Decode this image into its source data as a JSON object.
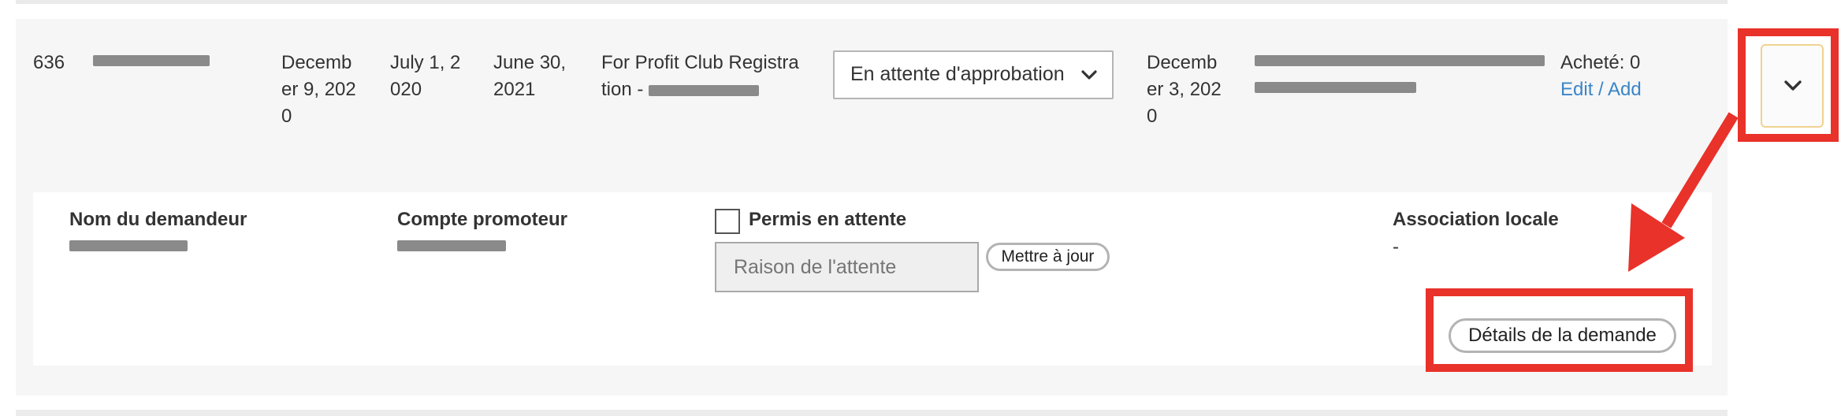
{
  "row": {
    "id": "636",
    "submitted_date": "Decemb\ner 9, 202\n0",
    "start_date": "July 1, 2\n020",
    "end_date": "June 30,\n2021",
    "type_label": "For Profit Club Registra\ntion - ",
    "status_select": {
      "selected": "En attente d'approbation"
    },
    "decision_date": "Decemb\ner 3, 202\n0",
    "purchased_text": "Acheté: 0",
    "edit_add_link": "Edit / Add"
  },
  "details": {
    "requester_label": "Nom du demandeur",
    "promoter_label": "Compte promoteur",
    "permit_pending_label": "Permis en attente",
    "reason_placeholder": "Raison de l'attente",
    "update_button": "Mettre à jour",
    "local_assoc_label": "Association locale",
    "local_assoc_value": "-",
    "request_details_button": "Détails de la demande"
  },
  "annotation": {
    "highlight_color": "#e8322a"
  }
}
